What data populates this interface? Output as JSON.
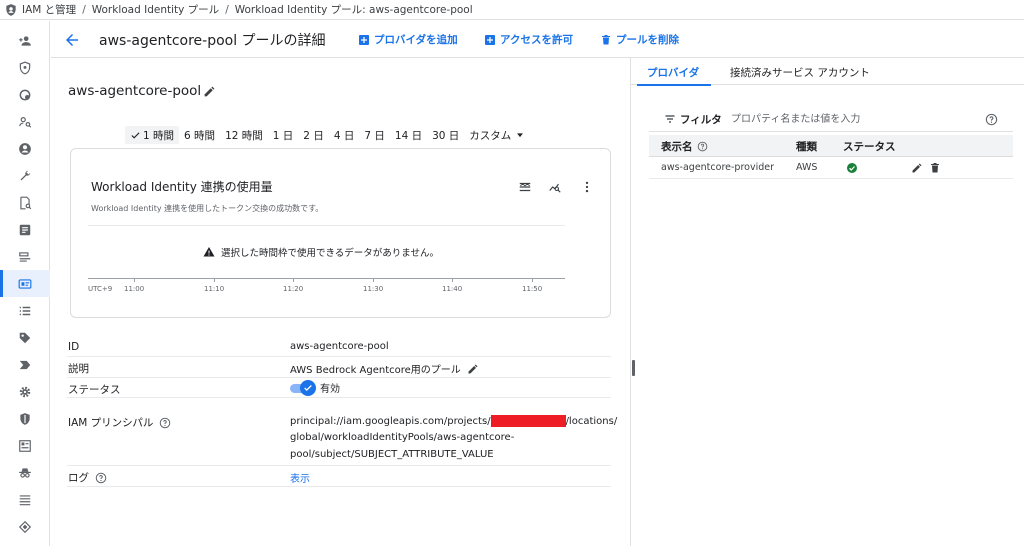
{
  "breadcrumb": {
    "items": [
      "IAM と管理",
      "Workload Identity プール",
      "Workload Identity プール: aws-agentcore-pool"
    ],
    "separator": "/"
  },
  "header": {
    "title": "aws-agentcore-pool プールの詳細",
    "add_provider": "プロバイダを追加",
    "grant_access": "アクセスを許可",
    "delete_pool": "プールを削除"
  },
  "pool": {
    "name": "aws-agentcore-pool"
  },
  "time_range": {
    "options": [
      "1 時間",
      "6 時間",
      "12 時間",
      "1 日",
      "2 日",
      "4 日",
      "7 日",
      "14 日",
      "30 日",
      "カスタム"
    ],
    "selected": "1 時間"
  },
  "chart_data": {
    "type": "line",
    "title": "Workload Identity 連携の使用量",
    "subtitle": "Workload Identity 連携を使用したトークン交換の成功数です。",
    "no_data": "選択した時間枠で使用できるデータがありません。",
    "timezone": "UTC+9",
    "x": [
      "11:00",
      "11:10",
      "11:20",
      "11:30",
      "11:40",
      "11:50"
    ],
    "series": []
  },
  "details": {
    "id_label": "ID",
    "id_value": "aws-agentcore-pool",
    "desc_label": "説明",
    "desc_value": "AWS Bedrock Agentcore用のプール",
    "status_label": "ステータス",
    "status_value": "有効",
    "principal_label": "IAM プリンシパル",
    "principal_line1_a": "principal://iam.googleapis.com/projects/",
    "principal_line1_b": "/locations/",
    "principal_line2": "global/workloadIdentityPools/aws-agentcore-",
    "principal_line3": "pool/subject/SUBJECT_ATTRIBUTE_VALUE",
    "log_label": "ログ",
    "log_value": "表示"
  },
  "right_panel": {
    "tabs": [
      "プロバイダ",
      "接続済みサービス アカウント"
    ],
    "active_tab": "プロバイダ",
    "filter": {
      "label": "フィルタ",
      "placeholder": "プロパティ名または値を入力"
    },
    "columns": [
      "表示名",
      "種類",
      "ステータス"
    ],
    "rows": [
      {
        "display_name": "aws-agentcore-provider",
        "type": "AWS",
        "status": "enabled"
      }
    ]
  },
  "colors": {
    "accent": "#1a73e8",
    "success": "#188038",
    "redaction": "#ee1c25"
  }
}
